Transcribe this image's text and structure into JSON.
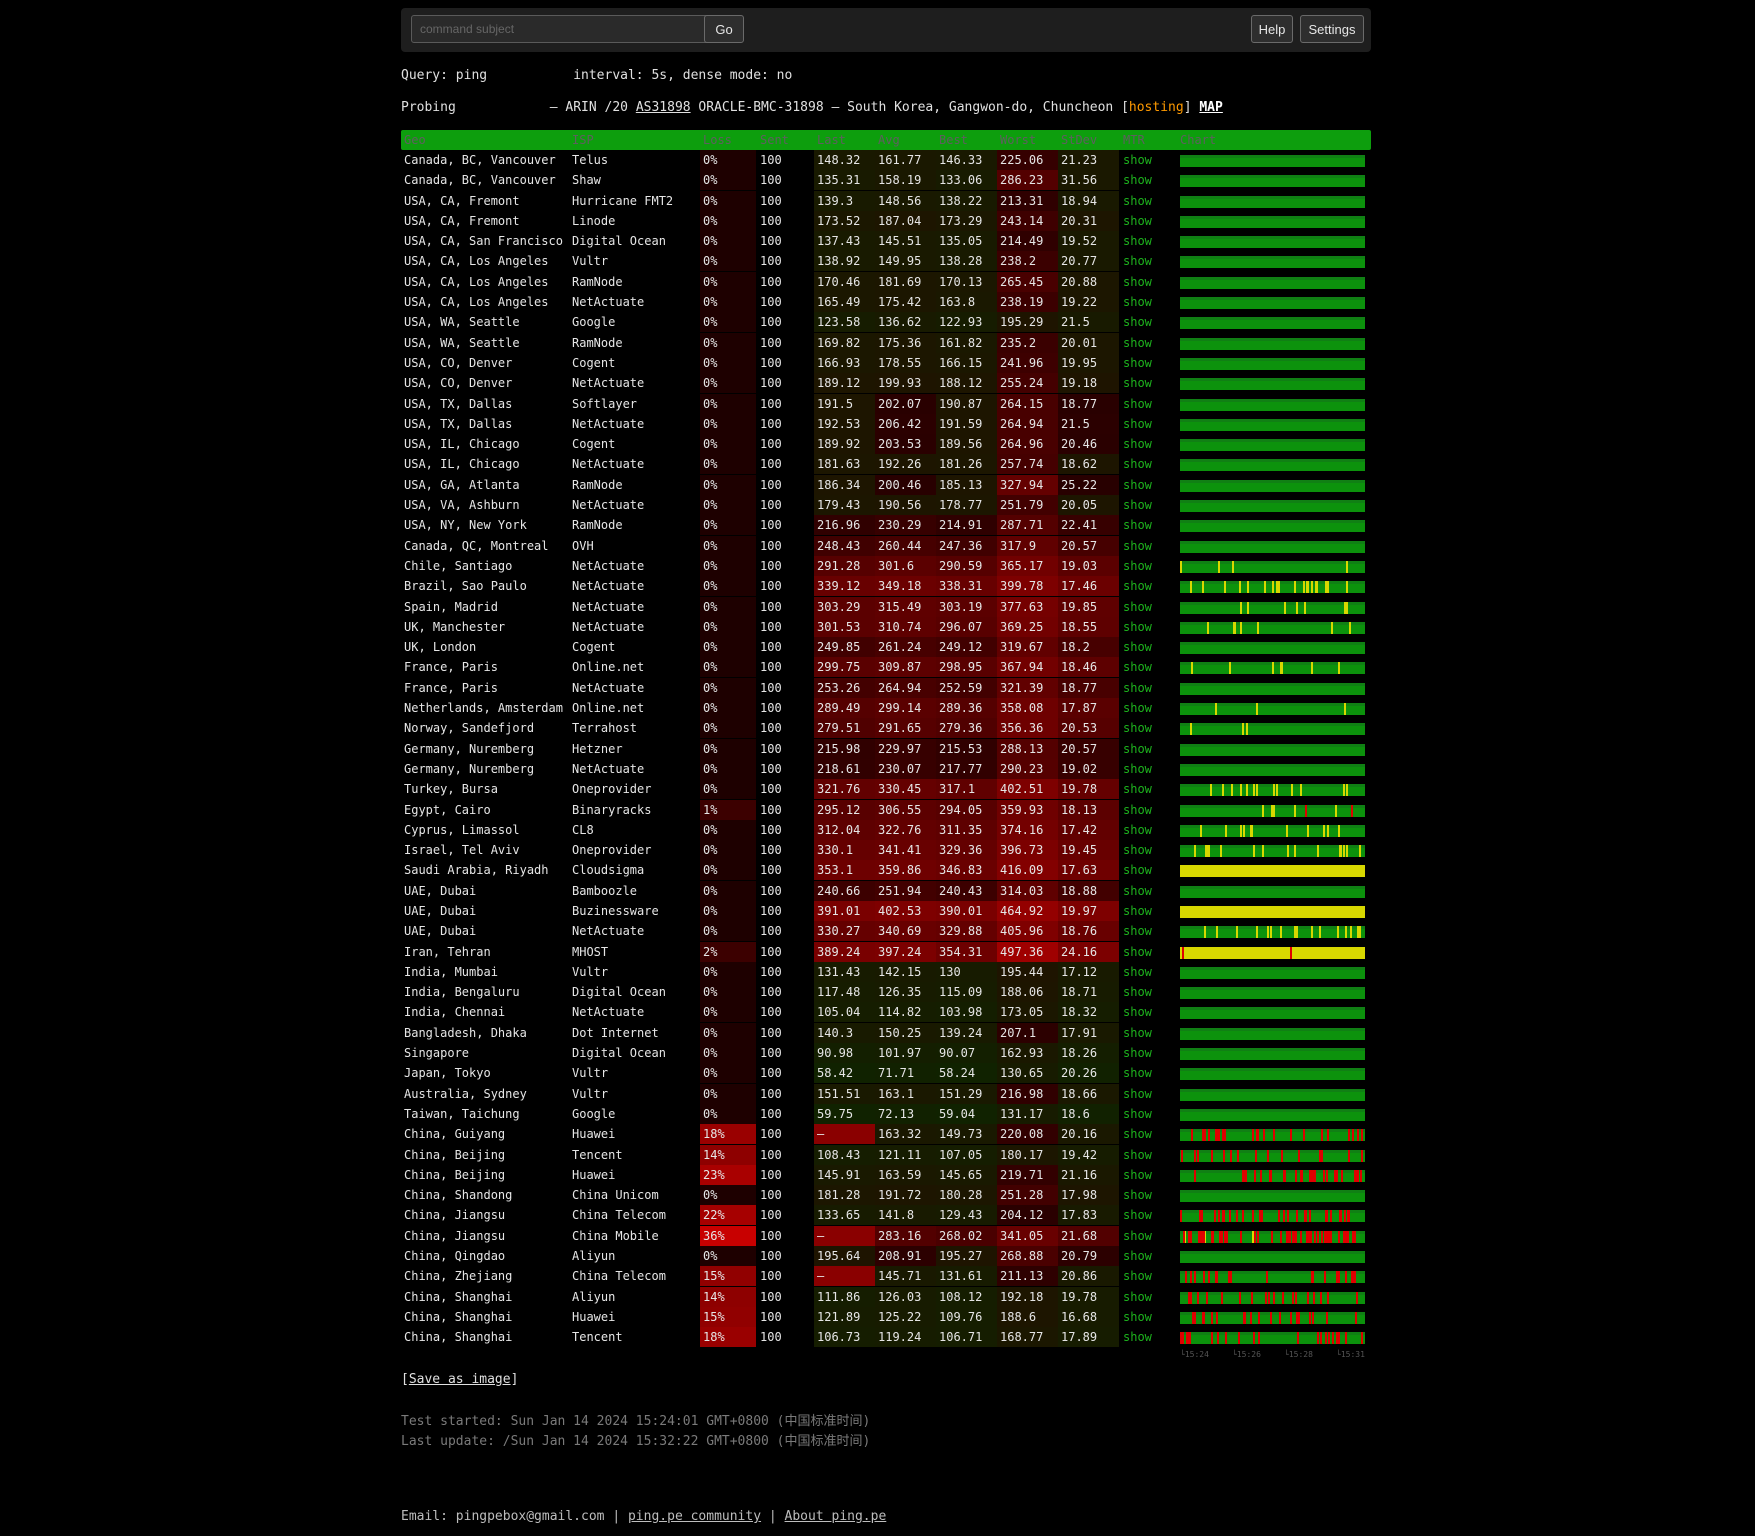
{
  "topbar": {
    "placeholder": "command subject",
    "go": "Go",
    "help": "Help",
    "settings": "Settings"
  },
  "query": {
    "label": "Query: ping",
    "interval": "interval: 5s, dense mode: no"
  },
  "probing": {
    "label": "Probing",
    "prefix": "– ARIN /20 ",
    "asn": "AS31898",
    "desc": " ORACLE-BMC-31898 – South Korea, Gangwon-do, Chuncheon [",
    "tag": "hosting",
    "suffix": "] ",
    "map": "MAP"
  },
  "columns": [
    "Geo",
    "ISP",
    "Loss",
    "Sent",
    "Last",
    "Avg",
    "Best",
    "Worst",
    "StDev",
    "MTR",
    "Chart"
  ],
  "mtr_label": "show",
  "rows": [
    [
      "Canada, BC, Vancouver",
      "Telus",
      "0%",
      "100",
      "148.32",
      "161.77",
      "146.33",
      "225.06",
      "21.23"
    ],
    [
      "Canada, BC, Vancouver",
      "Shaw",
      "0%",
      "100",
      "135.31",
      "158.19",
      "133.06",
      "286.23",
      "31.56"
    ],
    [
      "USA, CA, Fremont",
      "Hurricane FMT2",
      "0%",
      "100",
      "139.3",
      "148.56",
      "138.22",
      "213.31",
      "18.94"
    ],
    [
      "USA, CA, Fremont",
      "Linode",
      "0%",
      "100",
      "173.52",
      "187.04",
      "173.29",
      "243.14",
      "20.31"
    ],
    [
      "USA, CA, San Francisco",
      "Digital Ocean",
      "0%",
      "100",
      "137.43",
      "145.51",
      "135.05",
      "214.49",
      "19.52"
    ],
    [
      "USA, CA, Los Angeles",
      "Vultr",
      "0%",
      "100",
      "138.92",
      "149.95",
      "138.28",
      "238.2",
      "20.77"
    ],
    [
      "USA, CA, Los Angeles",
      "RamNode",
      "0%",
      "100",
      "170.46",
      "181.69",
      "170.13",
      "265.45",
      "20.88"
    ],
    [
      "USA, CA, Los Angeles",
      "NetActuate",
      "0%",
      "100",
      "165.49",
      "175.42",
      "163.8",
      "238.19",
      "19.22"
    ],
    [
      "USA, WA, Seattle",
      "Google",
      "0%",
      "100",
      "123.58",
      "136.62",
      "122.93",
      "195.29",
      "21.5"
    ],
    [
      "USA, WA, Seattle",
      "RamNode",
      "0%",
      "100",
      "169.82",
      "175.36",
      "161.82",
      "235.2",
      "20.01"
    ],
    [
      "USA, CO, Denver",
      "Cogent",
      "0%",
      "100",
      "166.93",
      "178.55",
      "166.15",
      "241.96",
      "19.95"
    ],
    [
      "USA, CO, Denver",
      "NetActuate",
      "0%",
      "100",
      "189.12",
      "199.93",
      "188.12",
      "255.24",
      "19.18"
    ],
    [
      "USA, TX, Dallas",
      "Softlayer",
      "0%",
      "100",
      "191.5",
      "202.07",
      "190.87",
      "264.15",
      "18.77"
    ],
    [
      "USA, TX, Dallas",
      "NetActuate",
      "0%",
      "100",
      "192.53",
      "206.42",
      "191.59",
      "264.94",
      "21.5"
    ],
    [
      "USA, IL, Chicago",
      "Cogent",
      "0%",
      "100",
      "189.92",
      "203.53",
      "189.56",
      "264.96",
      "20.46"
    ],
    [
      "USA, IL, Chicago",
      "NetActuate",
      "0%",
      "100",
      "181.63",
      "192.26",
      "181.26",
      "257.74",
      "18.62"
    ],
    [
      "USA, GA, Atlanta",
      "RamNode",
      "0%",
      "100",
      "186.34",
      "200.46",
      "185.13",
      "327.94",
      "25.22"
    ],
    [
      "USA, VA, Ashburn",
      "NetActuate",
      "0%",
      "100",
      "179.43",
      "190.56",
      "178.77",
      "251.79",
      "20.05"
    ],
    [
      "USA, NY, New York",
      "RamNode",
      "0%",
      "100",
      "216.96",
      "230.29",
      "214.91",
      "287.71",
      "22.41"
    ],
    [
      "Canada, QC, Montreal",
      "OVH",
      "0%",
      "100",
      "248.43",
      "260.44",
      "247.36",
      "317.9",
      "20.57"
    ],
    [
      "Chile, Santiago",
      "NetActuate",
      "0%",
      "100",
      "291.28",
      "301.6",
      "290.59",
      "365.17",
      "19.03"
    ],
    [
      "Brazil, Sao Paulo",
      "NetActuate",
      "0%",
      "100",
      "339.12",
      "349.18",
      "338.31",
      "399.78",
      "17.46"
    ],
    [
      "Spain, Madrid",
      "NetActuate",
      "0%",
      "100",
      "303.29",
      "315.49",
      "303.19",
      "377.63",
      "19.85"
    ],
    [
      "UK, Manchester",
      "NetActuate",
      "0%",
      "100",
      "301.53",
      "310.74",
      "296.07",
      "369.25",
      "18.55"
    ],
    [
      "UK, London",
      "Cogent",
      "0%",
      "100",
      "249.85",
      "261.24",
      "249.12",
      "319.67",
      "18.2"
    ],
    [
      "France, Paris",
      "Online.net",
      "0%",
      "100",
      "299.75",
      "309.87",
      "298.95",
      "367.94",
      "18.46"
    ],
    [
      "France, Paris",
      "NetActuate",
      "0%",
      "100",
      "253.26",
      "264.94",
      "252.59",
      "321.39",
      "18.77"
    ],
    [
      "Netherlands, Amsterdam",
      "Online.net",
      "0%",
      "100",
      "289.49",
      "299.14",
      "289.36",
      "358.08",
      "17.87"
    ],
    [
      "Norway, Sandefjord",
      "Terrahost",
      "0%",
      "100",
      "279.51",
      "291.65",
      "279.36",
      "356.36",
      "20.53"
    ],
    [
      "Germany, Nuremberg",
      "Hetzner",
      "0%",
      "100",
      "215.98",
      "229.97",
      "215.53",
      "288.13",
      "20.57"
    ],
    [
      "Germany, Nuremberg",
      "NetActuate",
      "0%",
      "100",
      "218.61",
      "230.07",
      "217.77",
      "290.23",
      "19.02"
    ],
    [
      "Turkey, Bursa",
      "Oneprovider",
      "0%",
      "100",
      "321.76",
      "330.45",
      "317.1",
      "402.51",
      "19.78"
    ],
    [
      "Egypt, Cairo",
      "Binaryracks",
      "1%",
      "100",
      "295.12",
      "306.55",
      "294.05",
      "359.93",
      "18.13"
    ],
    [
      "Cyprus, Limassol",
      "CL8",
      "0%",
      "100",
      "312.04",
      "322.76",
      "311.35",
      "374.16",
      "17.42"
    ],
    [
      "Israel, Tel Aviv",
      "Oneprovider",
      "0%",
      "100",
      "330.1",
      "341.41",
      "329.36",
      "396.73",
      "19.45"
    ],
    [
      "Saudi Arabia, Riyadh",
      "Cloudsigma",
      "0%",
      "100",
      "353.1",
      "359.86",
      "346.83",
      "416.09",
      "17.63"
    ],
    [
      "UAE, Dubai",
      "Bamboozle",
      "0%",
      "100",
      "240.66",
      "251.94",
      "240.43",
      "314.03",
      "18.88"
    ],
    [
      "UAE, Dubai",
      "Buzinessware",
      "0%",
      "100",
      "391.01",
      "402.53",
      "390.01",
      "464.92",
      "19.97"
    ],
    [
      "UAE, Dubai",
      "NetActuate",
      "0%",
      "100",
      "330.27",
      "340.69",
      "329.88",
      "405.96",
      "18.76"
    ],
    [
      "Iran, Tehran",
      "MHOST",
      "2%",
      "100",
      "389.24",
      "397.24",
      "354.31",
      "497.36",
      "24.16"
    ],
    [
      "India, Mumbai",
      "Vultr",
      "0%",
      "100",
      "131.43",
      "142.15",
      "130",
      "195.44",
      "17.12"
    ],
    [
      "India, Bengaluru",
      "Digital Ocean",
      "0%",
      "100",
      "117.48",
      "126.35",
      "115.09",
      "188.06",
      "18.71"
    ],
    [
      "India, Chennai",
      "NetActuate",
      "0%",
      "100",
      "105.04",
      "114.82",
      "103.98",
      "173.05",
      "18.32"
    ],
    [
      "Bangladesh, Dhaka",
      "Dot Internet",
      "0%",
      "100",
      "140.3",
      "150.25",
      "139.24",
      "207.1",
      "17.91"
    ],
    [
      "Singapore",
      "Digital Ocean",
      "0%",
      "100",
      "90.98",
      "101.97",
      "90.07",
      "162.93",
      "18.26"
    ],
    [
      "Japan, Tokyo",
      "Vultr",
      "0%",
      "100",
      "58.42",
      "71.71",
      "58.24",
      "130.65",
      "20.26"
    ],
    [
      "Australia, Sydney",
      "Vultr",
      "0%",
      "100",
      "151.51",
      "163.1",
      "151.29",
      "216.98",
      "18.66"
    ],
    [
      "Taiwan, Taichung",
      "Google",
      "0%",
      "100",
      "59.75",
      "72.13",
      "59.04",
      "131.17",
      "18.6"
    ],
    [
      "China, Guiyang",
      "Huawei",
      "18%",
      "100",
      "–",
      "163.32",
      "149.73",
      "220.08",
      "20.16"
    ],
    [
      "China, Beijing",
      "Tencent",
      "14%",
      "100",
      "108.43",
      "121.11",
      "107.05",
      "180.17",
      "19.42"
    ],
    [
      "China, Beijing",
      "Huawei",
      "23%",
      "100",
      "145.91",
      "163.59",
      "145.65",
      "219.71",
      "21.16"
    ],
    [
      "China, Shandong",
      "China Unicom",
      "0%",
      "100",
      "181.28",
      "191.72",
      "180.28",
      "251.28",
      "17.98"
    ],
    [
      "China, Jiangsu",
      "China Telecom",
      "22%",
      "100",
      "133.65",
      "141.8",
      "129.43",
      "204.12",
      "17.83"
    ],
    [
      "China, Jiangsu",
      "China Mobile",
      "36%",
      "100",
      "–",
      "283.16",
      "268.02",
      "341.05",
      "21.68"
    ],
    [
      "China, Qingdao",
      "Aliyun",
      "0%",
      "100",
      "195.64",
      "208.91",
      "195.27",
      "268.88",
      "20.79"
    ],
    [
      "China, Zhejiang",
      "China Telecom",
      "15%",
      "100",
      "–",
      "145.71",
      "131.61",
      "211.13",
      "20.86"
    ],
    [
      "China, Shanghai",
      "Aliyun",
      "14%",
      "100",
      "111.86",
      "126.03",
      "108.12",
      "192.18",
      "19.78"
    ],
    [
      "China, Shanghai",
      "Huawei",
      "15%",
      "100",
      "121.89",
      "125.22",
      "109.76",
      "188.6",
      "16.68"
    ],
    [
      "China, Shanghai",
      "Tencent",
      "18%",
      "100",
      "106.73",
      "119.24",
      "106.71",
      "168.77",
      "17.89"
    ]
  ],
  "chart_axis": [
    "└15:24",
    "└15:26",
    "└15:28",
    "└15:31"
  ],
  "save_link": "Save as image",
  "save_prefix": "[",
  "save_suffix": "]",
  "test_started": "Test started: Sun Jan 14 2024 15:24:01 GMT+0800 (中国标准时间)",
  "last_update": "Last update: /Sun Jan 14 2024 15:32:22 GMT+0800 (中国标准时间)",
  "footer": {
    "email": "Email: pingpebox@gmail.com",
    "sep": " | ",
    "community": "ping.pe community",
    "about": "About ping.pe"
  },
  "colors": {
    "header_green": "#0d9e0d",
    "chart_green": "#0c920c",
    "loss_red": "#b00000",
    "show_green": "#1db31d",
    "hosting": "#ff9a00"
  }
}
